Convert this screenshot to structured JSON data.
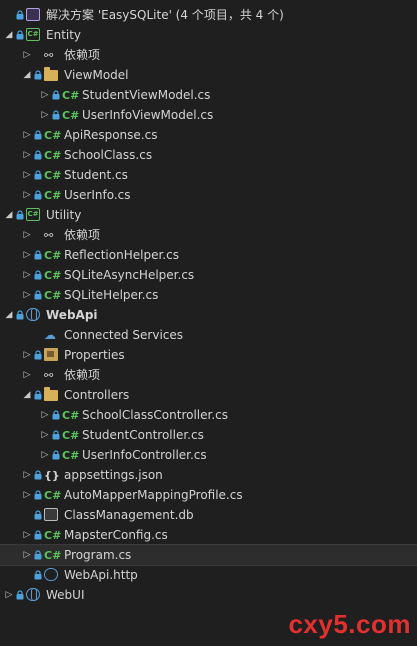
{
  "solution": {
    "label": "解决方案 'EasySQLite' (4 个项目，共 4 个)"
  },
  "tree": [
    {
      "level": 0,
      "arrow": "none",
      "lock": true,
      "icon": "solution-icon",
      "label_key": "solution"
    },
    {
      "level": 0,
      "arrow": "expanded",
      "lock": true,
      "icon": "csharp-project-icon",
      "label": "Entity"
    },
    {
      "level": 1,
      "arrow": "collapsed",
      "lock": false,
      "icon": "dependencies-icon",
      "label": "依赖项"
    },
    {
      "level": 1,
      "arrow": "expanded",
      "lock": true,
      "icon": "folder-icon",
      "label": "ViewModel"
    },
    {
      "level": 2,
      "arrow": "collapsed",
      "lock": true,
      "icon": "csharp-file-icon",
      "label": "StudentViewModel.cs"
    },
    {
      "level": 2,
      "arrow": "collapsed",
      "lock": true,
      "icon": "csharp-file-icon",
      "label": "UserInfoViewModel.cs"
    },
    {
      "level": 1,
      "arrow": "collapsed",
      "lock": true,
      "icon": "csharp-file-icon",
      "label": "ApiResponse.cs"
    },
    {
      "level": 1,
      "arrow": "collapsed",
      "lock": true,
      "icon": "csharp-file-icon",
      "label": "SchoolClass.cs"
    },
    {
      "level": 1,
      "arrow": "collapsed",
      "lock": true,
      "icon": "csharp-file-icon",
      "label": "Student.cs"
    },
    {
      "level": 1,
      "arrow": "collapsed",
      "lock": true,
      "icon": "csharp-file-icon",
      "label": "UserInfo.cs"
    },
    {
      "level": 0,
      "arrow": "expanded",
      "lock": true,
      "icon": "csharp-project-icon",
      "label": "Utility"
    },
    {
      "level": 1,
      "arrow": "collapsed",
      "lock": false,
      "icon": "dependencies-icon",
      "label": "依赖项"
    },
    {
      "level": 1,
      "arrow": "collapsed",
      "lock": true,
      "icon": "csharp-file-icon",
      "label": "ReflectionHelper.cs"
    },
    {
      "level": 1,
      "arrow": "collapsed",
      "lock": true,
      "icon": "csharp-file-icon",
      "label": "SQLiteAsyncHelper.cs"
    },
    {
      "level": 1,
      "arrow": "collapsed",
      "lock": true,
      "icon": "csharp-file-icon",
      "label": "SQLiteHelper.cs"
    },
    {
      "level": 0,
      "arrow": "expanded",
      "lock": true,
      "icon": "web-project-icon",
      "label": "WebApi",
      "bold": true
    },
    {
      "level": 1,
      "arrow": "none",
      "lock": false,
      "icon": "connected-services-icon",
      "label": "Connected Services"
    },
    {
      "level": 1,
      "arrow": "collapsed",
      "lock": true,
      "icon": "properties-icon",
      "label": "Properties"
    },
    {
      "level": 1,
      "arrow": "collapsed",
      "lock": false,
      "icon": "dependencies-icon",
      "label": "依赖项"
    },
    {
      "level": 1,
      "arrow": "expanded",
      "lock": true,
      "icon": "folder-icon",
      "label": "Controllers"
    },
    {
      "level": 2,
      "arrow": "collapsed",
      "lock": true,
      "icon": "csharp-file-icon",
      "label": "SchoolClassController.cs"
    },
    {
      "level": 2,
      "arrow": "collapsed",
      "lock": true,
      "icon": "csharp-file-icon",
      "label": "StudentController.cs"
    },
    {
      "level": 2,
      "arrow": "collapsed",
      "lock": true,
      "icon": "csharp-file-icon",
      "label": "UserInfoController.cs"
    },
    {
      "level": 1,
      "arrow": "collapsed",
      "lock": true,
      "icon": "json-file-icon",
      "label": "appsettings.json"
    },
    {
      "level": 1,
      "arrow": "collapsed",
      "lock": true,
      "icon": "csharp-file-icon",
      "label": "AutoMapperMappingProfile.cs"
    },
    {
      "level": 1,
      "arrow": "none",
      "lock": true,
      "icon": "database-file-icon",
      "label": "ClassManagement.db"
    },
    {
      "level": 1,
      "arrow": "collapsed",
      "lock": true,
      "icon": "csharp-file-icon",
      "label": "MapsterConfig.cs"
    },
    {
      "level": 1,
      "arrow": "collapsed",
      "lock": true,
      "icon": "csharp-file-icon",
      "label": "Program.cs",
      "selected": true
    },
    {
      "level": 1,
      "arrow": "none",
      "lock": true,
      "icon": "http-file-icon",
      "label": "WebApi.http"
    },
    {
      "level": 0,
      "arrow": "collapsed",
      "lock": true,
      "icon": "web-project-icon",
      "label": "WebUI"
    }
  ],
  "watermark": "cxy5.com",
  "colors": {
    "background": "#1f1f1f",
    "text": "#d4d4d4",
    "csharp": "#5cc45c",
    "folder": "#d8b05a",
    "lock": "#4aa3df",
    "watermark": "#e03030"
  }
}
